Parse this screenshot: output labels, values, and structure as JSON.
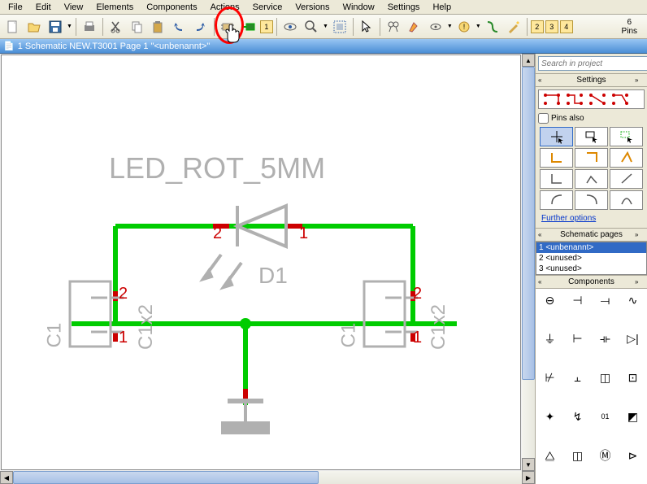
{
  "menu": [
    "File",
    "Edit",
    "View",
    "Elements",
    "Components",
    "Actions",
    "Service",
    "Versions",
    "Window",
    "Settings",
    "Help"
  ],
  "toolbar": {
    "pins_count": "6",
    "pins_label": "Pins",
    "num_active": "1",
    "nums": [
      "2",
      "3",
      "4"
    ]
  },
  "doc_title": "1 Schematic NEW.T3001 Page 1 \"<unbenannt>\"",
  "search": {
    "placeholder": "Search in project"
  },
  "panels": {
    "settings": "Settings",
    "pins_also": "Pins also",
    "further": "Further options",
    "sch_pages": "Schematic pages",
    "components": "Components"
  },
  "pages": [
    {
      "num": "1",
      "name": "<unbenannt>",
      "sel": true
    },
    {
      "num": "2",
      "name": "<unused>",
      "sel": false
    },
    {
      "num": "3",
      "name": "<unused>",
      "sel": false
    }
  ],
  "schematic": {
    "title": "LED_ROT_5MM",
    "d1": "D1",
    "c1_left": "C1",
    "c1x2_left": "C1x2",
    "c1_right": "C1",
    "c1x2_right": "C1x2",
    "pin1": "1",
    "pin2": "2"
  }
}
